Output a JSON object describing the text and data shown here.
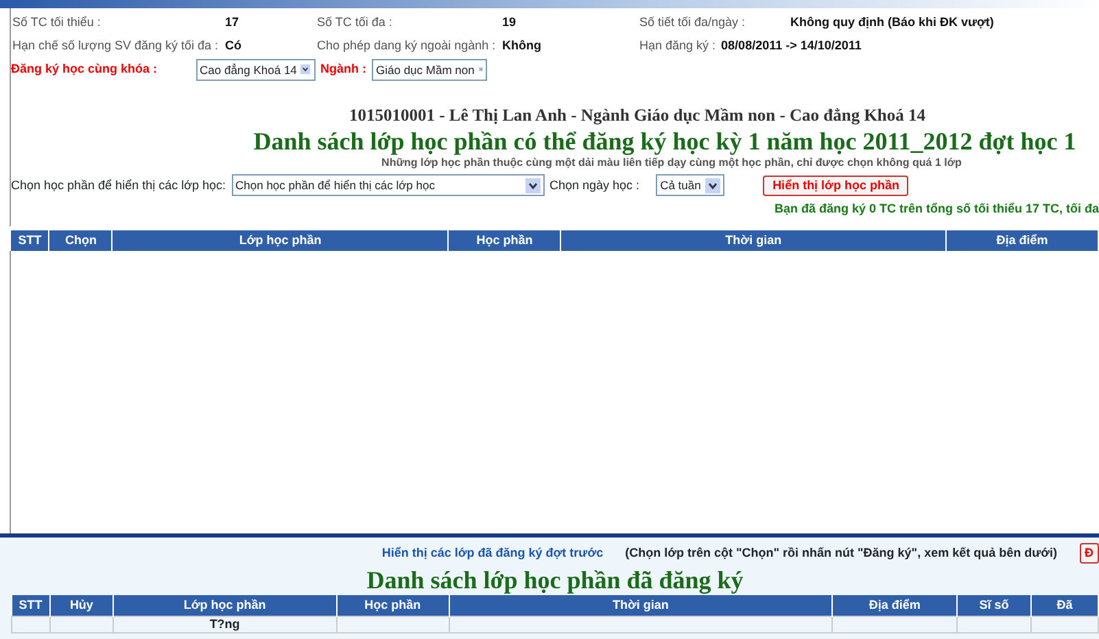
{
  "info": [
    {
      "label": "Số TC tối thiểu :",
      "value": "17"
    },
    {
      "label": "Số TC tối đa :",
      "value": "19"
    },
    {
      "label": "Số tiết tối đa/ngày :",
      "value": "Không quy định (Báo khi ĐK vượt)"
    },
    {
      "label": "Hạn chế số lượng SV đăng ký tối đa :",
      "value": "Có"
    },
    {
      "label": "Cho phép dang ký ngoài ngành :",
      "value": "Không"
    },
    {
      "label": "Hạn đăng ký :",
      "value": "08/08/2011 -> 14/10/2011"
    }
  ],
  "cohort": {
    "label": "Đăng ký học cùng khóa :",
    "value": "Cao đẳng Khoá 14"
  },
  "major": {
    "label": "Ngành :",
    "value": "Giáo dục Mầm non"
  },
  "student": "1015010001 - Lê Thị Lan Anh - Ngành Giáo dục Mầm non - Cao đẳng Khoá 14",
  "title": "Danh sách lớp học phần có thể đăng ký học kỳ 1 năm học 2011_2012 đợt học 1",
  "note": "Những lớp học phần thuộc cùng một dải màu liên tiếp dạy cùng một học phần, chỉ được chọn không quá 1 lớp",
  "course_filter": {
    "label": "Chọn học phần để hiển thị các lớp học:",
    "value": "Chọn học phần để hiển thị các lớp học"
  },
  "day_filter": {
    "label": "Chọn ngày học :",
    "value": "Cả tuần"
  },
  "show_button": "Hiển thị lớp học phần",
  "summary": "Bạn đã đăng ký 0 TC trên tổng số tối thiểu 17 TC, tối đa",
  "classes_table": {
    "columns": [
      "STT",
      "Chọn",
      "Lớp học phần",
      "Học phần",
      "Thời gian",
      "Địa điểm"
    ]
  },
  "previous_link": "Hiển thị các lớp đã đăng ký đợt trước",
  "instruction": "(Chọn lớp trên cột \"Chọn\" rồi nhấn nút \"Đăng ký\", xem kết quả bên dưới)",
  "register_button": "Đ",
  "registered_title": "Danh sách lớp học phần đã đăng ký",
  "registered_table": {
    "columns": [
      "STT",
      "Hủy",
      "Lớp học phần",
      "Học phần",
      "Thời gian",
      "Địa điểm",
      "Sĩ số",
      "Đã"
    ],
    "rows": [
      [
        "",
        "",
        "T?ng",
        "",
        "",
        "",
        "",
        ""
      ]
    ]
  }
}
